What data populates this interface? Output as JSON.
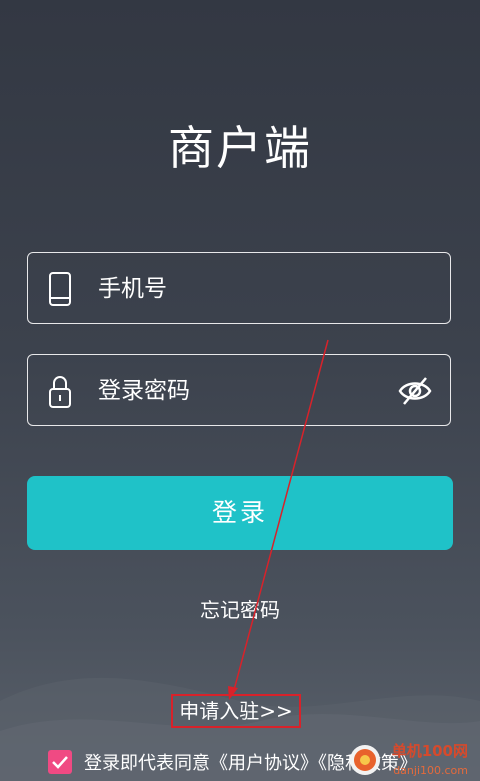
{
  "app_title": "商户端",
  "phone_field": {
    "placeholder": "手机号",
    "icon": "phone-icon"
  },
  "password_field": {
    "placeholder": "登录密码",
    "icon": "lock-icon",
    "toggle_icon": "eye-off-icon"
  },
  "login_button": {
    "label": "登录",
    "color": "#1fc2c8"
  },
  "forgot_password": "忘记密码",
  "apply_link": "申请入驻>>",
  "agreement": {
    "checked": true,
    "prefix": "登录即代表同意",
    "user_agreement": "《用户协议》",
    "privacy_policy": "《隐私政策》",
    "checkbox_color": "#f04a83"
  },
  "watermark": {
    "name": "单机100网",
    "url": "danji100.com"
  }
}
